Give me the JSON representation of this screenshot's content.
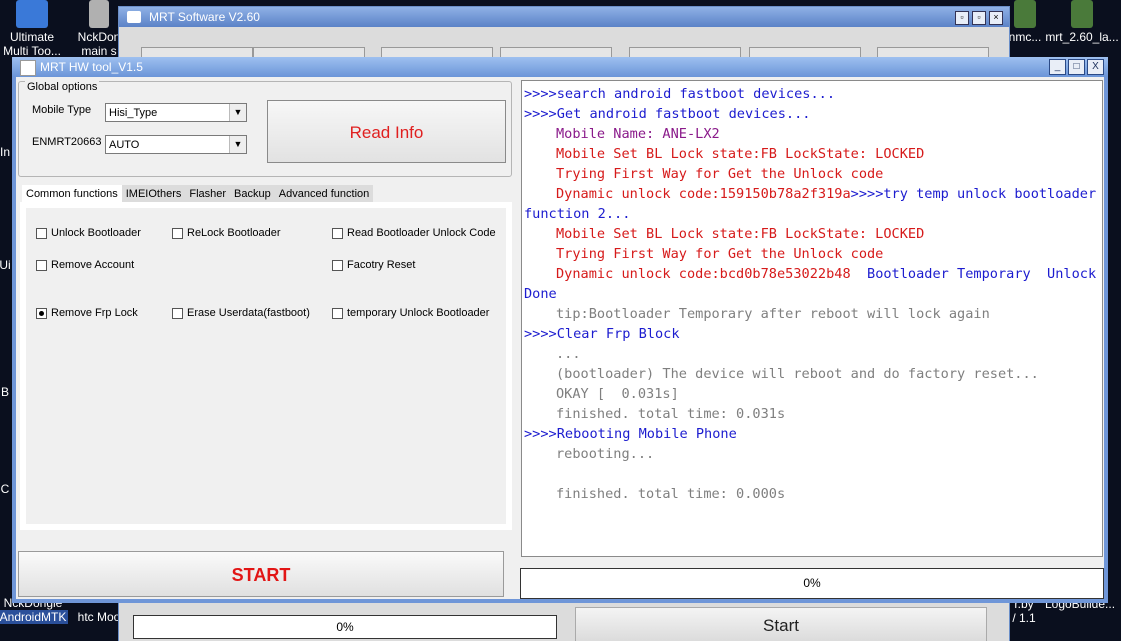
{
  "desktop": {
    "icons_left": [
      {
        "label_line1": "Ultimate",
        "label_line2": "Multi Too..."
      },
      {
        "label_line1": "NckDon",
        "label_line2": "main s"
      }
    ],
    "icons_right": [
      {
        "label": "nmc..."
      },
      {
        "label": "mrt_2.60_la..."
      }
    ],
    "bottom_left_labels": [
      "NckDongle",
      "AndroidMTK",
      "htc Moo"
    ],
    "bottom_right_labels": [
      "r.by",
      "LogoBuilde...",
      "/ 1.1"
    ],
    "side_fragments": [
      "In",
      "Ui",
      "B",
      "C"
    ]
  },
  "background_window": {
    "title": "MRT Software V2.60",
    "progress_text": "0%",
    "start_label": "Start"
  },
  "window": {
    "title": "MRT HW tool_V1.5",
    "controls": [
      "_",
      "□",
      "X"
    ]
  },
  "global_options": {
    "legend": "Global options",
    "mobile_type_label": "Mobile Type",
    "mobile_type_value": "Hisi_Type",
    "enmrt_label": "ENMRT20663",
    "enmrt_value": "AUTO",
    "read_info_label": "Read Info"
  },
  "tabs": [
    "Common functions",
    "IMEI",
    "Others",
    "Flasher",
    "Backup",
    "Advanced function"
  ],
  "checkboxes": {
    "unlock_bootloader": "Unlock Bootloader",
    "relock_bootloader": "ReLock Bootloader",
    "read_bl_unlock_code": "Read Bootloader Unlock Code",
    "remove_account": "Remove Account",
    "factory_reset": "Facotry Reset",
    "remove_frp": "Remove Frp Lock",
    "erase_userdata": "Erase Userdata(fastboot)",
    "temp_unlock_bl": "temporary Unlock Bootloader"
  },
  "start_label": "START",
  "log": {
    "l1": ">>>>search android fastboot devices...",
    "l2": ">>>>Get android fastboot devices...",
    "l3": "Mobile Name: ANE-LX2",
    "l4": "Mobile Set BL Lock state:FB LockState: LOCKED",
    "l5": "Trying First Way for Get the Unlock code",
    "l6a": "Dynamic unlock code:159150b78a2f319a",
    "l6b": ">>>>try temp unlock bootloader",
    "l7": "function 2...",
    "l8": "Mobile Set BL Lock state:FB LockState: LOCKED",
    "l9": "Trying First Way for Get the Unlock code",
    "l10a": "Dynamic unlock code:bcd0b78e53022b48",
    "l10b": "  Bootloader Temporary  Unlock",
    "l11": "Done",
    "l12": "tip:Bootloader Temporary after reboot will lock again",
    "l13": ">>>>Clear Frp Block",
    "l14": "...",
    "l15": "(bootloader) The device will reboot and do factory reset...",
    "l16": "OKAY [  0.031s]",
    "l17": "finished. total time: 0.031s",
    "l18": ">>>>Rebooting Mobile Phone",
    "l19": "rebooting...",
    "l20": "",
    "l21": "finished. total time: 0.000s"
  },
  "progress_text": "0%",
  "colors": {
    "log_blue": "#1c1ccf",
    "log_purple": "#8a1a8a",
    "log_red": "#d61a1a",
    "log_gray": "#7f7f7f",
    "button_red": "#e21515"
  }
}
